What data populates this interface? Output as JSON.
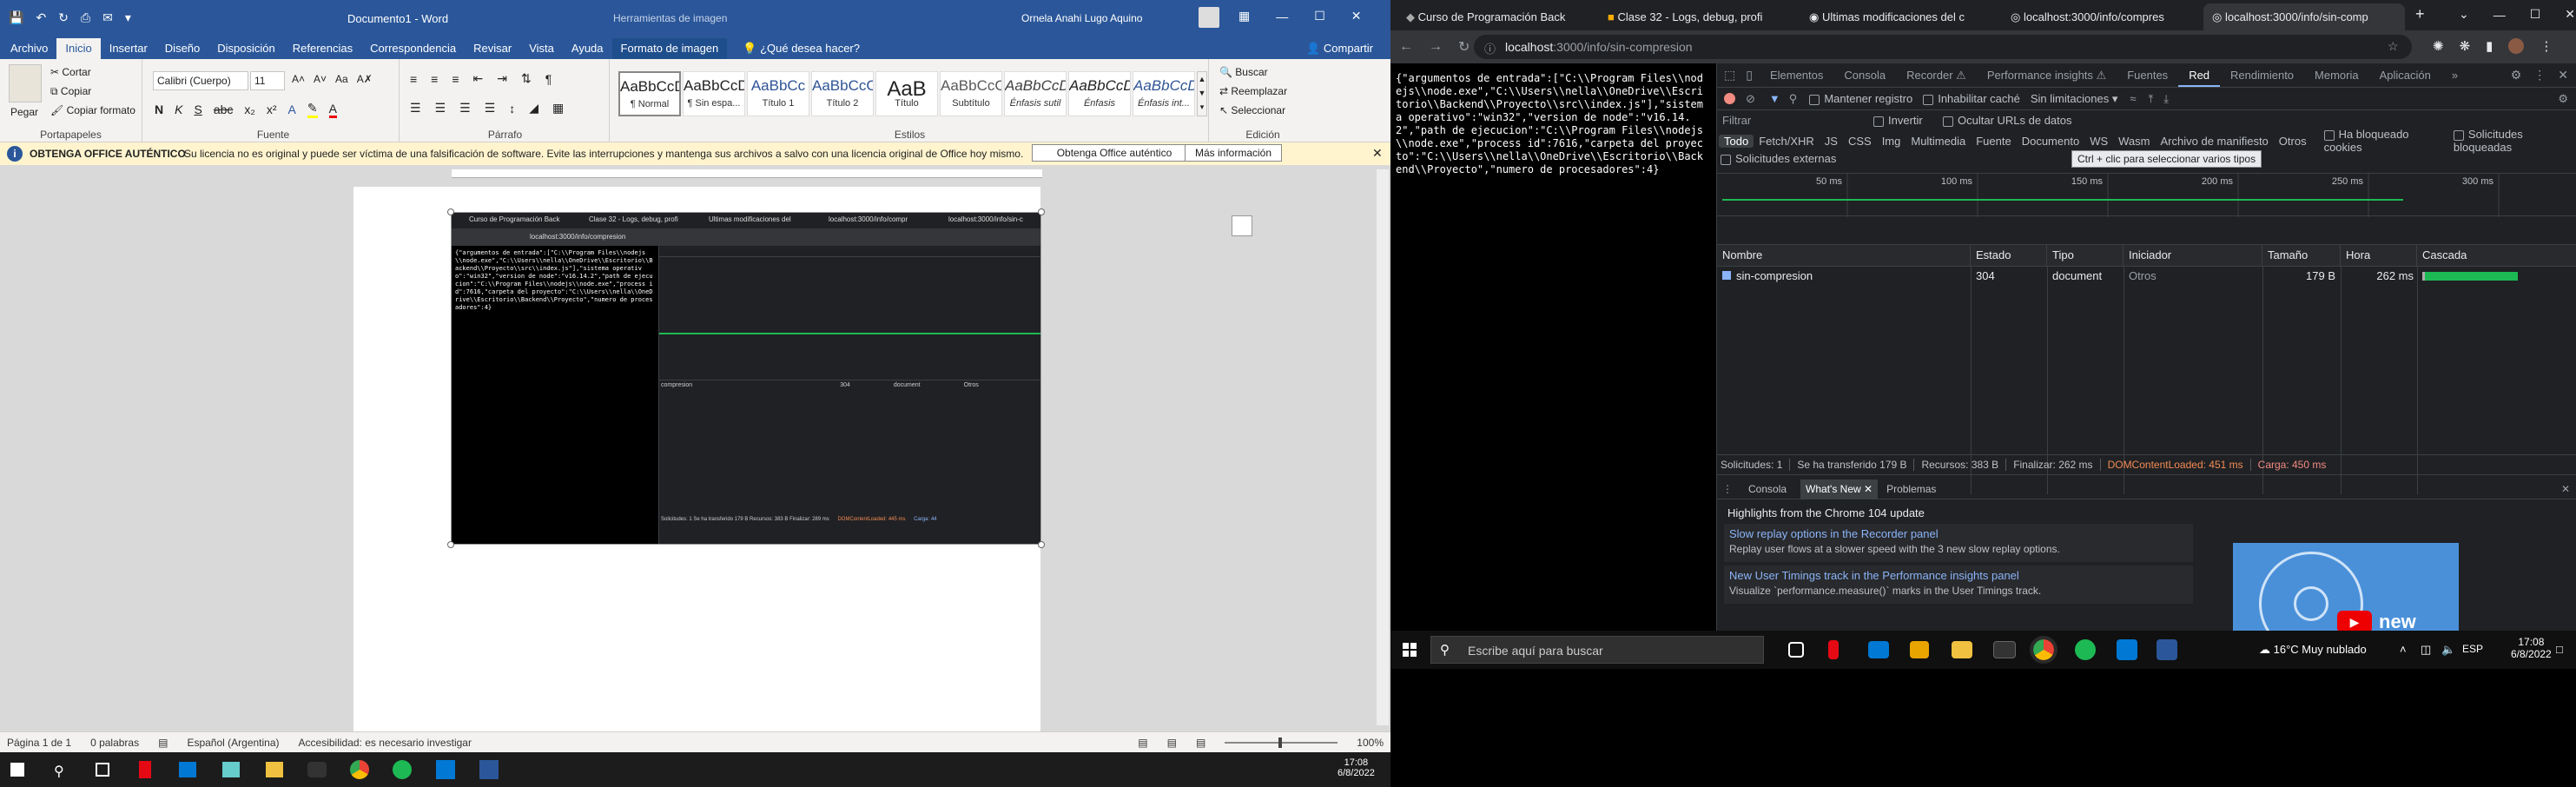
{
  "word": {
    "title": "Documento1 - Word",
    "picture_tools": "Herramientas de imagen",
    "user": "Ornela Anahi Lugo Aquino",
    "tabs": [
      "Archivo",
      "Inicio",
      "Insertar",
      "Diseño",
      "Disposición",
      "Referencias",
      "Correspondencia",
      "Revisar",
      "Vista",
      "Ayuda",
      "Formato de imagen"
    ],
    "tellme": "¿Qué desea hacer?",
    "share": "Compartir",
    "clipboard": {
      "paste": "Pegar",
      "cut": "Cortar",
      "copy": "Copiar",
      "format": "Copiar formato",
      "label": "Portapapeles"
    },
    "font": {
      "name": "Calibri (Cuerpo)",
      "size": "11",
      "label": "Fuente"
    },
    "paragraph_label": "Párrafo",
    "styles": [
      {
        "sample": "AaBbCcDc",
        "name": "¶ Normal"
      },
      {
        "sample": "AaBbCcDc",
        "name": "¶ Sin espa..."
      },
      {
        "sample": "AaBbCc",
        "name": "Título 1"
      },
      {
        "sample": "AaBbCcC",
        "name": "Título 2"
      },
      {
        "sample": "AaB",
        "name": "Título"
      },
      {
        "sample": "AaBbCcC",
        "name": "Subtítulo"
      },
      {
        "sample": "AaBbCcDc",
        "name": "Énfasis sutil"
      },
      {
        "sample": "AaBbCcDc",
        "name": "Énfasis"
      },
      {
        "sample": "AaBbCcDc",
        "name": "Énfasis int..."
      }
    ],
    "styles_label": "Estilos",
    "editing": {
      "find": "Buscar",
      "replace": "Reemplazar",
      "select": "Seleccionar",
      "label": "Edición"
    },
    "banner": {
      "title": "OBTENGA OFFICE AUTÉNTICO",
      "text": "Su licencia no es original y puede ser víctima de una falsificación de software. Evite las interrupciones y mantenga sus archivos a salvo con una licencia original de Office hoy mismo.",
      "btn1": "Obtenga Office auténtico",
      "btn2": "Más información"
    },
    "status": {
      "page": "Página 1 de 1",
      "words": "0 palabras",
      "lang": "Español (Argentina)",
      "access": "Accesibilidad: es necesario investigar",
      "zoom": "100%"
    },
    "taskbar_time": "17:08",
    "taskbar_date": "6/8/2022"
  },
  "embedded": {
    "tabs": [
      "Curso de Programación Back",
      "Clase 32 - Logs, debug, profi",
      "Ultimas modificaciones del",
      "localhost:3000/info/compr",
      "localhost:3000/info/sin-c"
    ],
    "url": "localhost:3000/info/compresion",
    "json": "{\"argumentos de entrada\":[\"C:\\\\Program Files\\\\nodejs\\\\node.exe\",\"C:\\\\Users\\\\nella\\\\OneDrive\\\\Escritorio\\\\Backend\\\\Proyecto\\\\src\\\\index.js\"],\"sistema operativo\":\"win32\",\"version de node\":\"v16.14.2\",\"path de ejecucion\":\"C:\\\\Program Files\\\\nodejs\\\\node.exe\",\"process id\":7616,\"carpeta del proyecto\":\"C:\\\\Users\\\\nella\\\\OneDrive\\\\Escritorio\\\\Backend\\\\Proyecto\",\"numero de procesadores\":4}",
    "row_name": "compresion",
    "row_status": "304",
    "row_type": "document",
    "row_init": "Otros",
    "summary": "Solicitudes: 1   Se ha transferido 179 B   Recursos: 383 B   Finalizar: 289 ms",
    "dcl": "DOMContentLoaded: 445 ms",
    "load": "Carga: 44"
  },
  "chrome": {
    "tabs": [
      {
        "title": "Curso de Programación Back"
      },
      {
        "title": "Clase 32 - Logs, debug, profi"
      },
      {
        "title": "Ultimas modificaciones del c"
      },
      {
        "title": "localhost:3000/info/compres"
      },
      {
        "title": "localhost:3000/info/sin-comp"
      }
    ],
    "url_host": "localhost",
    "url_path": ":3000/info/sin-compresion",
    "json": "{\"argumentos de entrada\":[\"C:\\\\Program Files\\\\nodejs\\\\node.exe\",\"C:\\\\Users\\\\nella\\\\OneDrive\\\\Escritorio\\\\Backend\\\\Proyecto\\\\src\\\\index.js\"],\"sistema operativo\":\"win32\",\"version de node\":\"v16.14.2\",\"path de ejecucion\":\"C:\\\\Program Files\\\\nodejs\\\\node.exe\",\"process id\":7616,\"carpeta del proyecto\":\"C:\\\\Users\\\\nella\\\\OneDrive\\\\Escritorio\\\\Backend\\\\Proyecto\",\"numero de procesadores\":4}"
  },
  "devtools": {
    "tabs": [
      "Elementos",
      "Consola",
      "Recorder ⚠",
      "Performance insights ⚠",
      "Fuentes",
      "Red",
      "Rendimiento",
      "Memoria",
      "Aplicación",
      "»"
    ],
    "active_tab": "Red",
    "preserve": "Mantener registro",
    "disable_cache": "Inhabilitar caché",
    "throttle": "Sin limitaciones",
    "filter": "Filtrar",
    "invert": "Invertir",
    "hide_urls": "Ocultar URLs de datos",
    "types": [
      "Todo",
      "Fetch/XHR",
      "JS",
      "CSS",
      "Img",
      "Multimedia",
      "Fuente",
      "Documento",
      "WS",
      "Wasm",
      "Archivo de manifiesto",
      "Otros"
    ],
    "blocked_cookies": "Ha bloqueado cookies",
    "blocked_requests": "Solicitudes bloqueadas",
    "third_party": "Solicitudes externas",
    "tooltip": "Ctrl + clic para seleccionar varios tipos",
    "ticks": [
      "50 ms",
      "100 ms",
      "150 ms",
      "200 ms",
      "250 ms",
      "300 ms"
    ],
    "columns": [
      "Nombre",
      "Estado",
      "Tipo",
      "Iniciador",
      "Tamaño",
      "Hora",
      "Cascada"
    ],
    "row": {
      "name": "sin-compresion",
      "status": "304",
      "type": "document",
      "initiator": "Otros",
      "size": "179 B",
      "time": "262 ms"
    },
    "summary": {
      "req": "Solicitudes: 1",
      "transfer": "Se ha transferido 179 B",
      "resources": "Recursos: 383 B",
      "finish": "Finalizar: 262 ms",
      "dcl": "DOMContentLoaded: 451 ms",
      "load": "Carga: 450 ms"
    },
    "drawer_tabs": [
      "Consola",
      "What's New",
      "Problemas"
    ],
    "highlights": "Highlights from the Chrome 104 update",
    "news": [
      {
        "title": "Slow replay options in the Recorder panel",
        "desc": "Replay user flows at a slower speed with the 3 new slow replay options."
      },
      {
        "title": "New User Timings track in the Performance insights panel",
        "desc": "Visualize `performance.measure()` marks in the User Timings track."
      }
    ],
    "video_text": "new"
  },
  "taskbar": {
    "search": "Escribe aquí para buscar",
    "weather": "16°C  Muy nublado",
    "lang": "ESP",
    "time": "17:08",
    "date": "6/8/2022"
  },
  "colors": {
    "word_blue": "#2b579a",
    "devtools_bg": "#202124",
    "accent": "#8ab4f8",
    "orange": "#f28b54"
  }
}
